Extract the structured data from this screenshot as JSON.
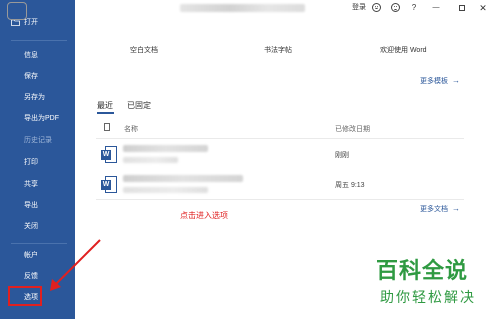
{
  "sidebar": {
    "open": "打开",
    "info": "信息",
    "save": "保存",
    "save_as": "另存为",
    "export_pdf": "导出为PDF",
    "history": "历史记录",
    "print": "打印",
    "share": "共享",
    "export": "导出",
    "close": "关闭",
    "account": "帐户",
    "feedback": "反馈",
    "options": "选项",
    "bg_color": "#2b579a"
  },
  "titlebar": {
    "login": "登录",
    "help": "?",
    "minimize": "—",
    "close": "✕"
  },
  "templates": {
    "items": [
      "空白文档",
      "书法字帖",
      "欢迎使用 Word"
    ],
    "more": "更多模板"
  },
  "tabs": {
    "recent": "最近",
    "pinned": "已固定"
  },
  "file_list": {
    "col_name": "名称",
    "col_date": "已修改日期",
    "rows": [
      {
        "date": "刚刚"
      },
      {
        "date": "周五 9:13"
      }
    ],
    "more": "更多文档"
  },
  "annotation": "点击进入选项",
  "watermark": {
    "title": "百科全说",
    "subtitle": "助你轻松解决"
  }
}
